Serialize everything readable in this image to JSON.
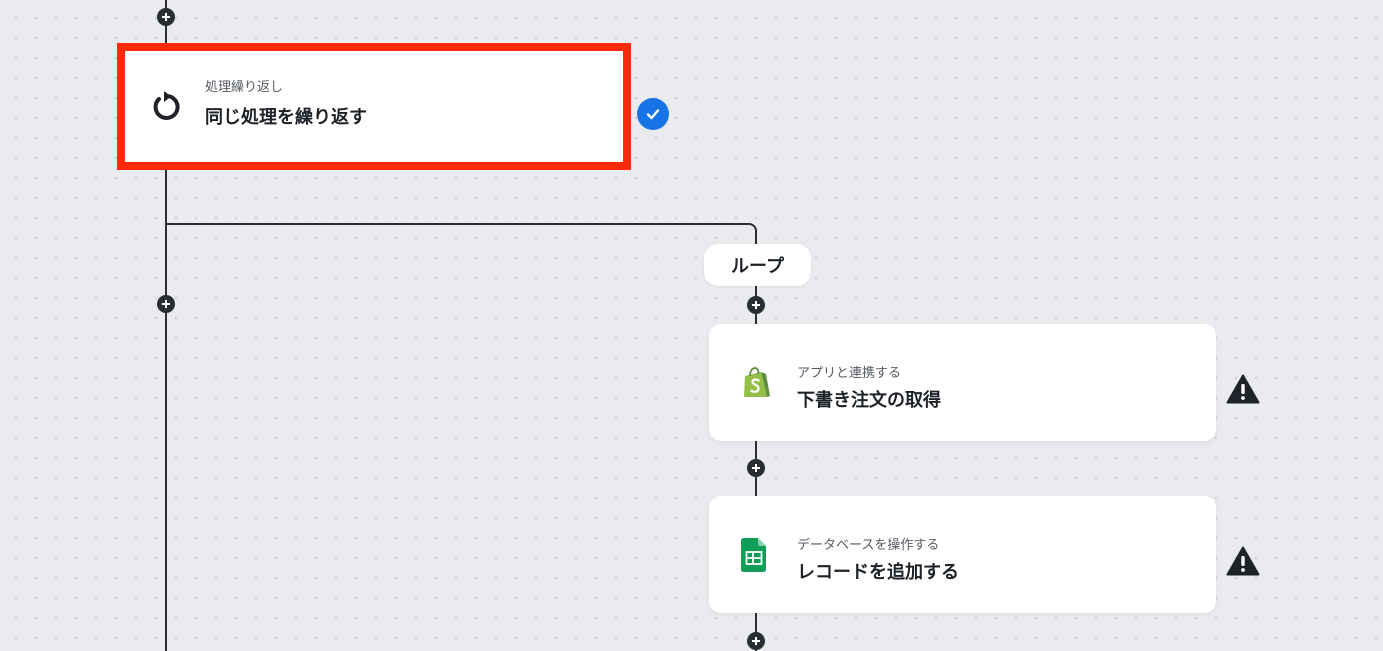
{
  "workflow": {
    "repeat_node": {
      "kind": "処理繰り返し",
      "title": "同じ処理を繰り返す",
      "icon": "repeat-arrow-icon",
      "status": "completed"
    },
    "loop_label": "ループ",
    "steps": [
      {
        "kind": "アプリと連携する",
        "title": "下書き注文の取得",
        "icon": "shopify-icon",
        "status": "warning"
      },
      {
        "kind": "データベースを操作する",
        "title": "レコードを追加する",
        "icon": "google-sheets-icon",
        "status": "warning"
      }
    ]
  },
  "colors": {
    "selection_border": "#ff2a0a",
    "check_badge": "#1774e6",
    "connector": "#2a2d33",
    "canvas": "#e9ebef"
  }
}
